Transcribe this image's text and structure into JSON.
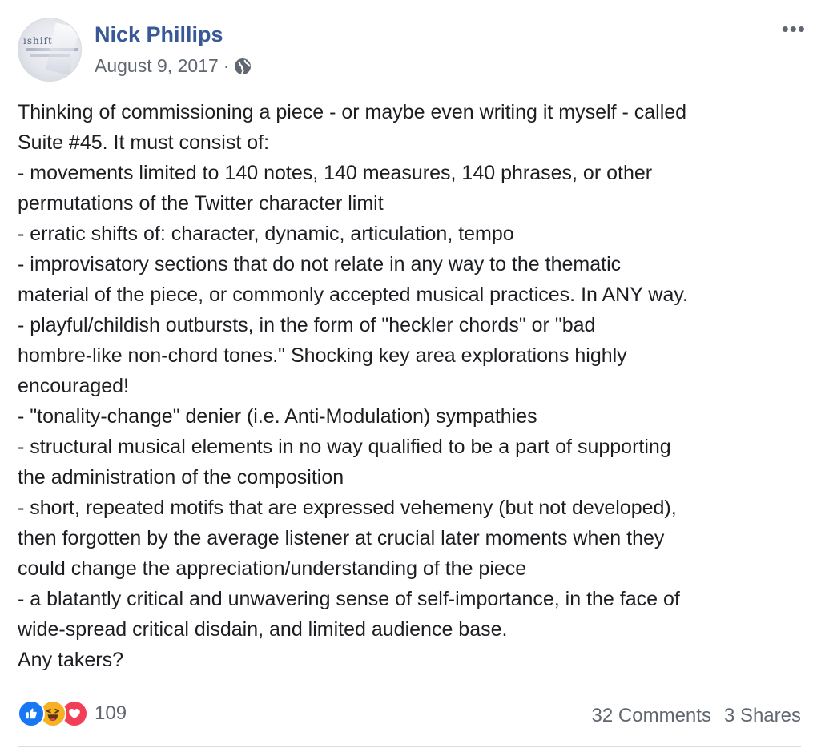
{
  "post": {
    "author": "Nick Phillips",
    "date": "August 9, 2017",
    "separator": "·",
    "privacy_icon": "globe-icon",
    "more_icon": "more-options-icon",
    "more_label": "•••",
    "avatar_text": "ıshift",
    "body_lines": [
      "Thinking of commissioning a piece - or maybe even writing it myself - called",
      "Suite #45. It must consist of:",
      "- movements limited to 140 notes, 140 measures, 140 phrases, or other",
      "permutations of the Twitter character limit",
      "- erratic shifts of: character, dynamic, articulation, tempo",
      "- improvisatory sections that do not relate in any way to the thematic",
      "material of the piece, or commonly accepted musical practices. In ANY way.",
      "- playful/childish outbursts, in the form of \"heckler chords\" or \"bad",
      "hombre-like non-chord tones.\" Shocking key area explorations highly",
      "encouraged!",
      "- \"tonality-change\" denier (i.e. Anti-Modulation) sympathies",
      "- structural musical elements in no way qualified to be a part of supporting",
      "the administration of the composition",
      "- short, repeated motifs that are expressed vehemeny (but not developed),",
      "then forgotten by the average listener at crucial later moments when they",
      "could change the appreciation/understanding of the piece",
      "- a blatantly critical and unwavering sense of self-importance, in the face of",
      "wide-spread critical disdain, and limited audience base.",
      "Any takers?"
    ]
  },
  "reactions": {
    "icons": [
      "like-icon",
      "haha-icon",
      "love-icon"
    ],
    "count": "109"
  },
  "stats": {
    "comments": "32 Comments",
    "shares": "3 Shares"
  },
  "colors": {
    "author": "#385898",
    "like": "#1877f2",
    "haha": "#f7b125",
    "love": "#f33e58",
    "secondary_text": "#606770"
  }
}
